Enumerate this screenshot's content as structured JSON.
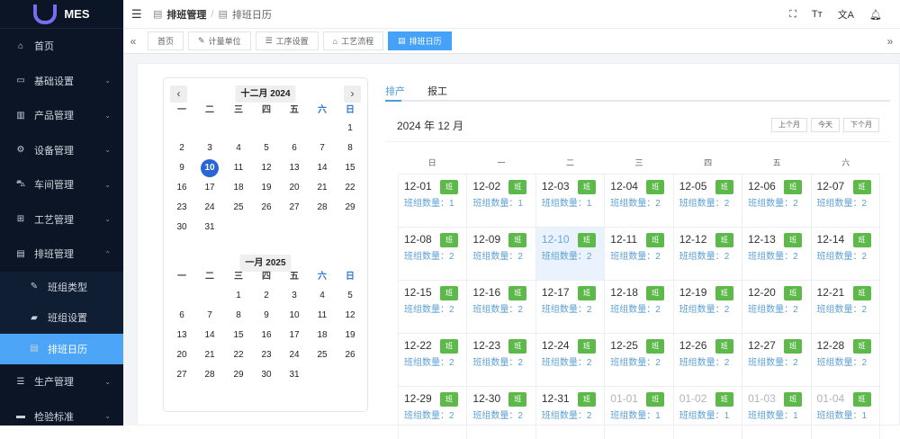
{
  "app": {
    "name": "MES"
  },
  "sidebar": {
    "items": [
      {
        "label": "首页",
        "icon": "home-icon",
        "glyph": "⌂"
      },
      {
        "label": "基础设置",
        "icon": "monitor-icon",
        "glyph": "▭",
        "chev": "⌄"
      },
      {
        "label": "产品管理",
        "icon": "chart-icon",
        "glyph": "▥",
        "chev": "⌄"
      },
      {
        "label": "设备管理",
        "icon": "gear-icon",
        "glyph": "⚙",
        "chev": "⌄"
      },
      {
        "label": "车间管理",
        "icon": "car-icon",
        "glyph": "⛍",
        "chev": "⌄"
      },
      {
        "label": "工艺管理",
        "icon": "process-icon",
        "glyph": "⊞",
        "chev": "⌄"
      },
      {
        "label": "排班管理",
        "icon": "calendar-icon",
        "glyph": "▤",
        "chev": "⌃"
      }
    ],
    "sub_items": [
      {
        "label": "班组类型",
        "icon": "pencil-icon",
        "glyph": "✎"
      },
      {
        "label": "班组设置",
        "icon": "book-icon",
        "glyph": "▰"
      },
      {
        "label": "排班日历",
        "icon": "calendar-icon",
        "glyph": "▤"
      }
    ],
    "after_items": [
      {
        "label": "生产管理",
        "icon": "database-icon",
        "glyph": "☰",
        "chev": "⌄"
      },
      {
        "label": "检验标准",
        "icon": "monitor-icon",
        "glyph": "▬",
        "chev": "⌄"
      }
    ]
  },
  "breadcrumb": [
    "排班管理",
    "排班日历"
  ],
  "tags": [
    {
      "label": "首页",
      "glyph": ""
    },
    {
      "label": "计量单位",
      "glyph": "✎"
    },
    {
      "label": "工序设置",
      "glyph": "☰"
    },
    {
      "label": "工艺流程",
      "glyph": "⌂"
    },
    {
      "label": "排班日历",
      "glyph": "▤",
      "active": true
    }
  ],
  "mini_calendar": {
    "weekdays": [
      "一",
      "二",
      "三",
      "四",
      "五",
      "六",
      "日"
    ],
    "months": [
      {
        "title": "十二月 2024",
        "offset": 6,
        "days": 31,
        "selected": 10
      },
      {
        "title": "一月 2025",
        "offset": 2,
        "days": 31
      }
    ]
  },
  "tabs": [
    {
      "label": "排产",
      "active": true
    },
    {
      "label": "报工"
    }
  ],
  "calendar": {
    "title": "2024 年 12 月",
    "buttons": [
      "上个月",
      "今天",
      "下个月"
    ],
    "weekdays": [
      "日",
      "一",
      "二",
      "三",
      "四",
      "五",
      "六"
    ],
    "badge": "班",
    "count_label": "班组数量：",
    "today": "12-10",
    "cells": [
      [
        "12-01",
        1
      ],
      [
        "12-02",
        1
      ],
      [
        "12-03",
        1
      ],
      [
        "12-04",
        2
      ],
      [
        "12-05",
        2
      ],
      [
        "12-06",
        2
      ],
      [
        "12-07",
        2
      ],
      [
        "12-08",
        2
      ],
      [
        "12-09",
        2
      ],
      [
        "12-10",
        2
      ],
      [
        "12-11",
        2
      ],
      [
        "12-12",
        2
      ],
      [
        "12-13",
        2
      ],
      [
        "12-14",
        2
      ],
      [
        "12-15",
        2
      ],
      [
        "12-16",
        2
      ],
      [
        "12-17",
        2
      ],
      [
        "12-18",
        2
      ],
      [
        "12-19",
        2
      ],
      [
        "12-20",
        2
      ],
      [
        "12-21",
        2
      ],
      [
        "12-22",
        2
      ],
      [
        "12-23",
        2
      ],
      [
        "12-24",
        2
      ],
      [
        "12-25",
        2
      ],
      [
        "12-26",
        2
      ],
      [
        "12-27",
        2
      ],
      [
        "12-28",
        2
      ],
      [
        "12-29",
        2
      ],
      [
        "12-30",
        2
      ],
      [
        "12-31",
        2
      ],
      [
        "01-01",
        1
      ],
      [
        "01-02",
        1
      ],
      [
        "01-03",
        1
      ],
      [
        "01-04",
        1
      ]
    ]
  },
  "header_icons": [
    {
      "name": "fullscreen-icon",
      "glyph": "⛶"
    },
    {
      "name": "font-size-icon",
      "glyph": "Tт"
    },
    {
      "name": "translate-icon",
      "glyph": "文A"
    },
    {
      "name": "bell-icon",
      "glyph": "🔔︎"
    }
  ]
}
